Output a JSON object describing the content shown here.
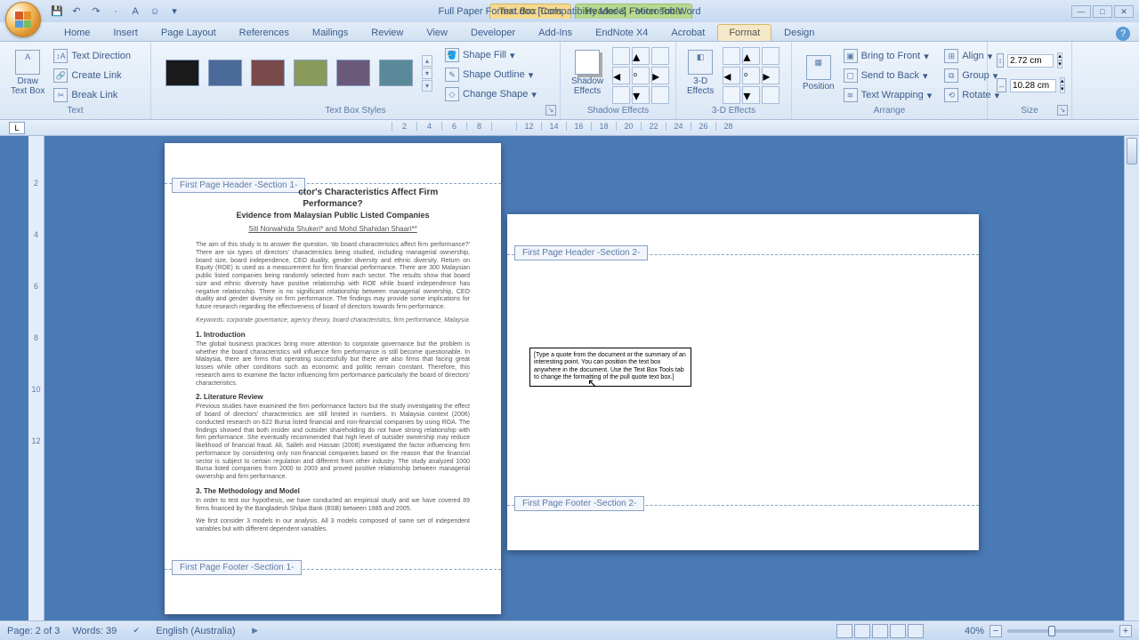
{
  "title": "Full Paper Format.doc [Compatibility Mode] - Microsoft Word",
  "context_tabs": {
    "textbox": "Text Box Tools",
    "headerfooter": "Header & Footer Tools"
  },
  "tabs": [
    "Home",
    "Insert",
    "Page Layout",
    "References",
    "Mailings",
    "Review",
    "View",
    "Developer",
    "Add-Ins",
    "EndNote X4",
    "Acrobat",
    "Format",
    "Design"
  ],
  "ribbon": {
    "text": {
      "label": "Text",
      "draw_textbox": "Draw\nText Box",
      "text_direction": "Text Direction",
      "create_link": "Create Link",
      "break_link": "Break Link"
    },
    "styles": {
      "label": "Text Box Styles",
      "shape_fill": "Shape Fill",
      "shape_outline": "Shape Outline",
      "change_shape": "Change Shape",
      "colors": [
        "#1a1a1a",
        "#4a6a9a",
        "#7a4a4a",
        "#8a9a5a",
        "#6a5a7a",
        "#5a8a9a"
      ]
    },
    "shadow": {
      "label": "Shadow Effects",
      "btn": "Shadow\nEffects"
    },
    "threed": {
      "label": "3-D Effects",
      "btn": "3-D\nEffects"
    },
    "arrange": {
      "label": "Arrange",
      "position": "Position",
      "bring_front": "Bring to Front",
      "send_back": "Send to Back",
      "text_wrap": "Text Wrapping",
      "align": "Align",
      "group": "Group",
      "rotate": "Rotate"
    },
    "size": {
      "label": "Size",
      "height": "2.72 cm",
      "width": "10.28 cm"
    }
  },
  "ruler_marks": [
    "2",
    "4",
    "6",
    "8",
    "",
    "12",
    "14",
    "16",
    "18",
    "20",
    "22",
    "24",
    "26",
    "28"
  ],
  "vruler_marks": [
    "",
    "2",
    "",
    "4",
    "6",
    "8",
    "10",
    "12"
  ],
  "page1": {
    "header_tag": "First Page Header -Section 1-",
    "footer_tag": "First Page Footer -Section 1-",
    "title_l1": "ctor's Characteristics Affect Firm",
    "title_l2": "Performance?",
    "subtitle": "Evidence from Malaysian Public Listed Companies",
    "authors": "Siti Norwahida Shukeri* and Mohd Shahidan Shaari**",
    "abstract": "The aim of this study is to answer the question, 'do board characteristics affect firm performance?' There are six types of directors' characteristics being studied, including managerial ownership, board size, board independence, CEO duality, gender diversity and ethnic diversity. Return on Equity (ROE) is used as a measurement for firm financial performance. There are 300 Malaysian public listed companies being randomly selected from each sector. The results show that board size and ethnic diversity have positive relationship with ROE while board independence has negative relationship. There is no significant relationship between managerial ownership, CEO duality and gender diversity on firm performance. The findings may provide some implications for future research regarding the effectiveness of board of directors towards firm performance.",
    "keywords": "Keywords: corporate governance, agency theory, board characteristics, firm performance, Malaysia",
    "sec1": "1. Introduction",
    "p1": "The global business practices bring more attention to corporate governance but the problem is whether the board characteristics will influence firm performance is still become questionable. In Malaysia, there are firms that operating successfully but there are also firms that facing great losses while other conditions such as economic and politic remain constant. Therefore, this research aims to examine the factor influencing firm performance particularly the board of directors' characteristics.",
    "sec2": "2. Literature Review",
    "p2": "Previous studies have examined the firm performance factors but the study investigating the effect of board of directors' characteristics are still limited in numbers. In Malaysia context (2006) conducted research on 622 Bursa listed financial and non-financial companies by using ROA. The findings showed that both insider and outsider shareholding do not have strong relationship with firm performance. She eventually recommended that high level of outsider ownership may reduce likelihood of financial fraud. Ali, Salleh and Hassan (2008) investigated the factor influencing firm performance by considering only non-financial companies based on the reason that the financial sector is subject to certain regulation and different from other industry. The study analyzed 1000 Bursa listed companies from 2000 to 2003 and proved positive relationship between managerial ownership and firm performance.",
    "sec3": "3. The Methodology and Model",
    "p3": "In order to test our hypothesis, we have conducted an empirical study and we have covered 89 firms financed by the Bangladesh Shilpa Bank (BSB) between 1985 and 2005.",
    "p4": "We first consider 3 models in our analysis. All 3 models composed of same set of independent variables but with different dependent variables."
  },
  "page2": {
    "header_tag": "First Page Header -Section 2-",
    "footer_tag": "First Page Footer -Section 2-",
    "textbox": "[Type a quote from the document or the summary of an interesting point. You can position the text box anywhere in the document. Use the Text Box Tools tab to change the formatting of the pull quote text box.]"
  },
  "status": {
    "page": "Page: 2 of 3",
    "words": "Words: 39",
    "lang": "English (Australia)",
    "zoom": "40%"
  }
}
